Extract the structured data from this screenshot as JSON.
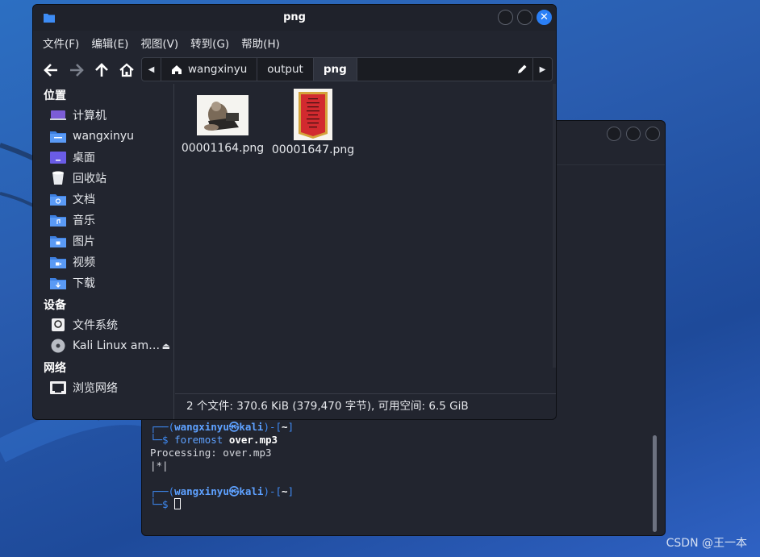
{
  "desktop": {
    "watermark": "CSDN @王一本"
  },
  "file_manager": {
    "title": "png",
    "menu": [
      "文件(F)",
      "编辑(E)",
      "视图(V)",
      "转到(G)",
      "帮助(H)"
    ],
    "path": [
      "wangxinyu",
      "output",
      "png"
    ],
    "sidebar": {
      "sections": [
        {
          "heading": "位置",
          "items": [
            {
              "label": "计算机",
              "icon": "computer-icon"
            },
            {
              "label": "wangxinyu",
              "icon": "home-folder-icon"
            },
            {
              "label": "桌面",
              "icon": "desktop-folder-icon"
            },
            {
              "label": "回收站",
              "icon": "trash-icon"
            },
            {
              "label": "文档",
              "icon": "documents-folder-icon"
            },
            {
              "label": "音乐",
              "icon": "music-folder-icon"
            },
            {
              "label": "图片",
              "icon": "pictures-folder-icon"
            },
            {
              "label": "视频",
              "icon": "videos-folder-icon"
            },
            {
              "label": "下载",
              "icon": "downloads-folder-icon"
            }
          ]
        },
        {
          "heading": "设备",
          "items": [
            {
              "label": "文件系统",
              "icon": "drive-icon"
            },
            {
              "label": "Kali Linux am…",
              "icon": "disc-icon"
            }
          ]
        },
        {
          "heading": "网络",
          "items": [
            {
              "label": "浏览网络",
              "icon": "network-icon"
            }
          ]
        }
      ]
    },
    "files": [
      {
        "name": "00001164.png"
      },
      {
        "name": "00001647.png"
      }
    ],
    "status": "2 个文件: 370.6 KiB (379,470 字节), 可用空间: 6.5 GiB"
  },
  "terminal": {
    "prompt1_user": "wangxinyu",
    "prompt1_at": "㉿",
    "prompt1_host": "kali",
    "prompt1_dir": "~",
    "cmd": "foremost",
    "cmd_arg": "over.mp3",
    "output1": "Processing: over.mp3",
    "output2": "|*|",
    "prompt2_user": "wangxinyu",
    "prompt2_at": "㉿",
    "prompt2_host": "kali",
    "prompt2_dir": "~"
  },
  "colors": {
    "accent": "#2a7ff6",
    "window_bg": "#22252f",
    "desktop": "#2a5db0"
  }
}
